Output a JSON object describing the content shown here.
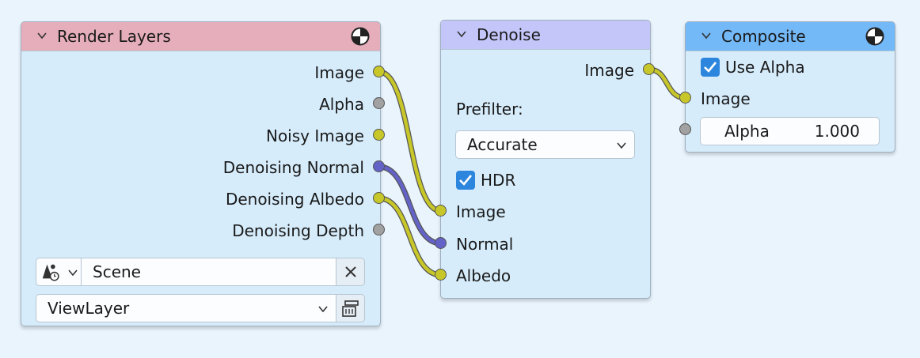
{
  "nodes": {
    "render_layers": {
      "title": "Render Layers",
      "header_color": "#e5aeba",
      "outputs": [
        "Image",
        "Alpha",
        "Noisy Image",
        "Denoising Normal",
        "Denoising Albedo",
        "Denoising Depth"
      ],
      "scene_value": "Scene",
      "layer_value": "ViewLayer"
    },
    "denoise": {
      "title": "Denoise",
      "header_color": "#c4c6fa",
      "output": "Image",
      "prefilter_label": "Prefilter:",
      "prefilter_value": "Accurate",
      "hdr_label": "HDR",
      "hdr_checked": true,
      "inputs": [
        "Image",
        "Normal",
        "Albedo"
      ]
    },
    "composite": {
      "title": "Composite",
      "header_color": "#73b8f7",
      "use_alpha_label": "Use Alpha",
      "use_alpha_checked": true,
      "input": "Image",
      "alpha_label": "Alpha",
      "alpha_value": "1.000"
    }
  },
  "colors": {
    "socket_color": "#c7c729",
    "vector_socket": "#6363c7",
    "value_socket": "#a1a1a1",
    "background": "#eaf4fd",
    "checkbox": "#2d86de"
  }
}
